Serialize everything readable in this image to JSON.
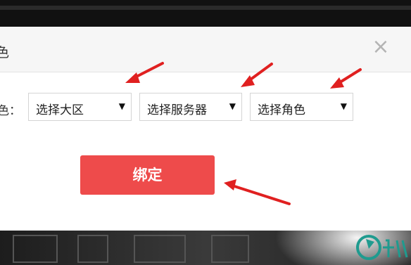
{
  "dialog": {
    "title": "色",
    "close_symbol": "×",
    "field_label": "色：",
    "selects": [
      {
        "value": "选择大区",
        "arrow": "▼"
      },
      {
        "value": "选择服务器",
        "arrow": "▼"
      },
      {
        "value": "选择角色",
        "arrow": "▼"
      }
    ],
    "bind_label": "绑定"
  },
  "colors": {
    "accent": "#ee4b4b",
    "annotation": "#e02020"
  },
  "icons": {
    "close": "close-icon",
    "dropdown": "caret-down-icon",
    "annotation": "red-arrow-icon",
    "watermark": "jiuyou-logo-icon"
  }
}
